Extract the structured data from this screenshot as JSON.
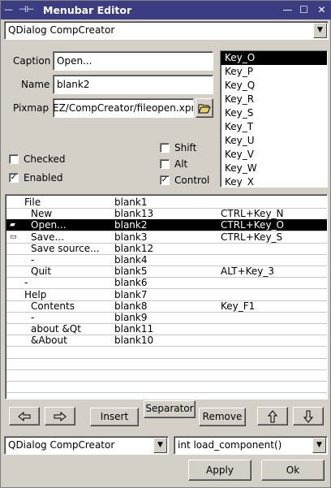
{
  "window": {
    "title": "Menubar Editor",
    "title_icons": [
      "pin-icon"
    ],
    "controls": [
      "minimize-icon",
      "maximize-icon",
      "close-icon"
    ]
  },
  "top_combo": {
    "value": "QDialog CompCreator"
  },
  "form": {
    "caption_label": "Caption",
    "caption_value": "Open...",
    "name_label": "Name",
    "name_value": "blank2",
    "pixmap_label": "Pixmap",
    "pixmap_value": "EZ/CompCreator/fileopen.xpm"
  },
  "keys": {
    "items": [
      "Key_O",
      "Key_P",
      "Key_Q",
      "Key_R",
      "Key_S",
      "Key_T",
      "Key_U",
      "Key_V",
      "Key_W",
      "Key_X"
    ],
    "selected": "Key_O"
  },
  "checks": {
    "checked_label": "Checked",
    "checked": false,
    "enabled_label": "Enabled",
    "enabled": true,
    "shift_label": "Shift",
    "shift": false,
    "alt_label": "Alt",
    "alt": false,
    "control_label": "Control",
    "control": true
  },
  "menu_rows": [
    {
      "caption": "File",
      "name": "blank1",
      "accel": "",
      "indent": 1,
      "icon": ""
    },
    {
      "caption": "New",
      "name": "blank13",
      "accel": "CTRL+Key_N",
      "indent": 2,
      "icon": ""
    },
    {
      "caption": "Open...",
      "name": "blank2",
      "accel": "CTRL+Key_O",
      "indent": 2,
      "icon": "folder-icon",
      "selected": true
    },
    {
      "caption": "Save...",
      "name": "blank3",
      "accel": "CTRL+Key_S",
      "indent": 2,
      "icon": "disk-icon"
    },
    {
      "caption": "Save source...",
      "name": "blank12",
      "accel": "",
      "indent": 2,
      "icon": ""
    },
    {
      "caption": "-",
      "name": "blank4",
      "accel": "",
      "indent": 2,
      "icon": ""
    },
    {
      "caption": "Quit",
      "name": "blank5",
      "accel": "ALT+Key_3",
      "indent": 2,
      "icon": ""
    },
    {
      "caption": "-",
      "name": "blank6",
      "accel": "",
      "indent": 1,
      "icon": ""
    },
    {
      "caption": "Help",
      "name": "blank7",
      "accel": "",
      "indent": 1,
      "icon": ""
    },
    {
      "caption": "Contents",
      "name": "blank8",
      "accel": "Key_F1",
      "indent": 2,
      "icon": ""
    },
    {
      "caption": "-",
      "name": "blank9",
      "accel": "",
      "indent": 2,
      "icon": ""
    },
    {
      "caption": "about &Qt",
      "name": "blank11",
      "accel": "",
      "indent": 2,
      "icon": ""
    },
    {
      "caption": "&About",
      "name": "blank10",
      "accel": "",
      "indent": 2,
      "icon": ""
    }
  ],
  "buttons": {
    "left_arrow": "arrow-left-icon",
    "right_arrow": "arrow-right-icon",
    "insert": "Insert",
    "separator": "Separator",
    "remove": "Remove",
    "up_arrow": "arrow-up-icon",
    "down_arrow": "arrow-down-icon",
    "apply": "Apply",
    "ok": "Ok"
  },
  "bottom_combos": {
    "class_value": "QDialog CompCreator",
    "slot_value": "int load_component()"
  }
}
